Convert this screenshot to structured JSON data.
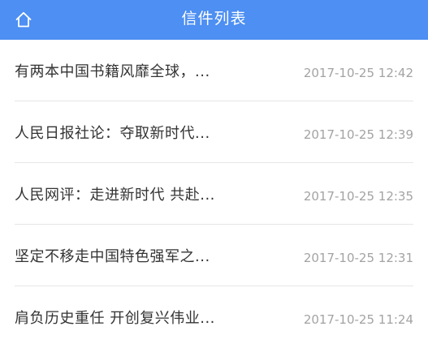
{
  "header": {
    "title": "信件列表",
    "home_icon": "home-icon",
    "background_color": "#4d8ff2"
  },
  "letters": [
    {
      "title": "有两本中国书籍风靡全球，...",
      "time": "2017-10-25 12:42"
    },
    {
      "title": "人民日报社论：夺取新时代...",
      "time": "2017-10-25 12:39"
    },
    {
      "title": "人民网评：走进新时代 共赴...",
      "time": "2017-10-25 12:35"
    },
    {
      "title": "坚定不移走中国特色强军之...",
      "time": "2017-10-25 12:31"
    },
    {
      "title": "肩负历史重任 开创复兴伟业...",
      "time": "2017-10-25 11:24"
    }
  ]
}
